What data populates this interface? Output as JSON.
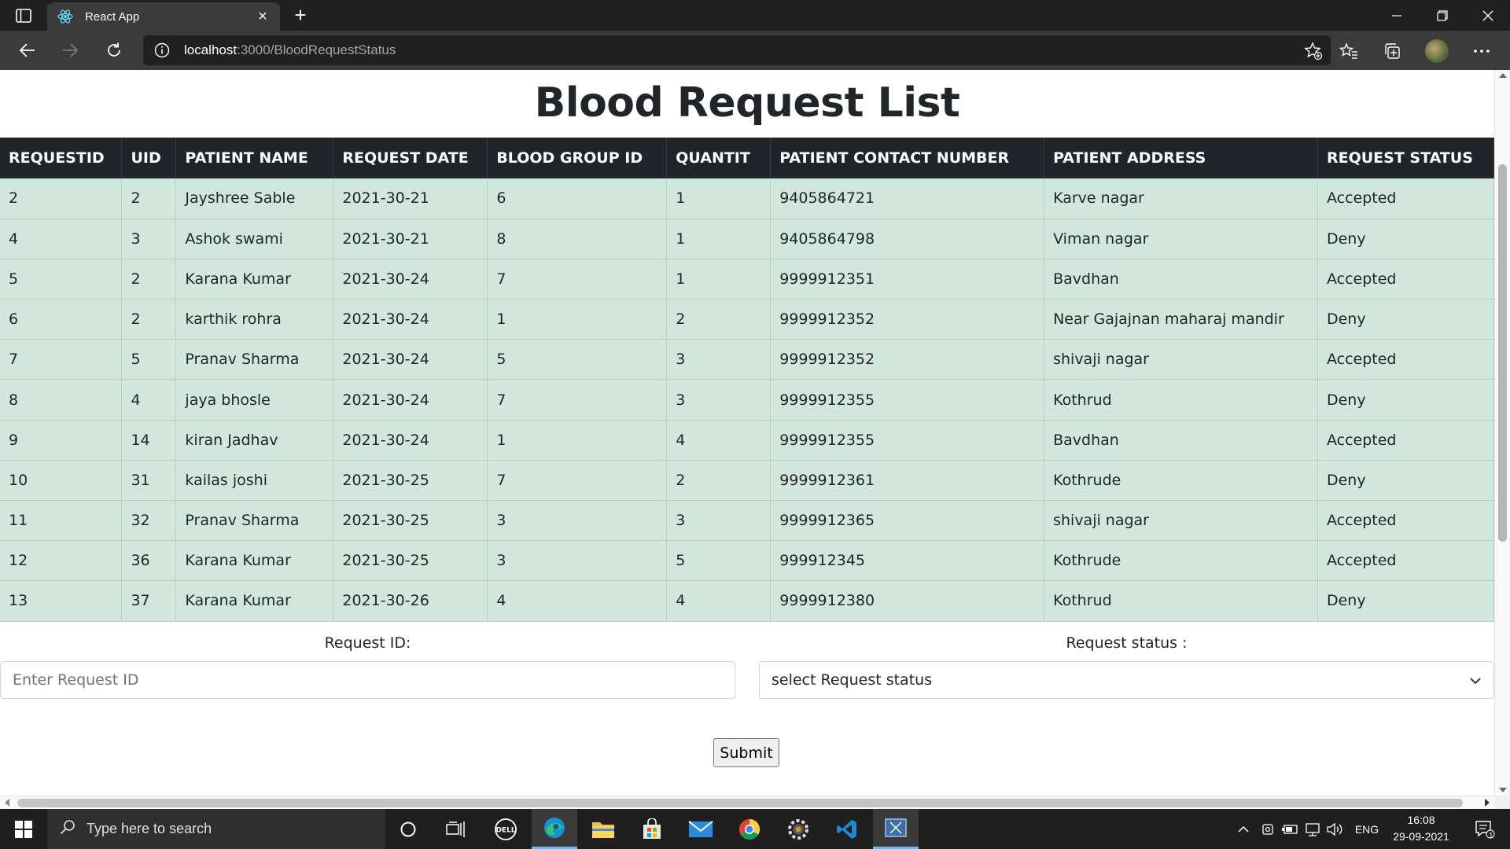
{
  "browser": {
    "tab_title": "React App",
    "url_host": "localhost",
    "url_path": ":3000/BloodRequestStatus"
  },
  "page": {
    "title": "Blood Request List"
  },
  "table": {
    "headers": [
      "REQUESTID",
      "UID",
      "PATIENT NAME",
      "REQUEST DATE",
      "BLOOD GROUP ID",
      "QUANTIT",
      "PATIENT CONTACT NUMBER",
      "PATIENT ADDRESS",
      "REQUEST STATUS"
    ],
    "rows": [
      [
        "2",
        "2",
        "Jayshree Sable",
        "2021-30-21",
        "6",
        "1",
        "9405864721",
        "Karve nagar",
        "Accepted"
      ],
      [
        "4",
        "3",
        "Ashok swami",
        "2021-30-21",
        "8",
        "1",
        "9405864798",
        "Viman nagar",
        "Deny"
      ],
      [
        "5",
        "2",
        "Karana Kumar",
        "2021-30-24",
        "7",
        "1",
        "9999912351",
        "Bavdhan",
        "Accepted"
      ],
      [
        "6",
        "2",
        "karthik rohra",
        "2021-30-24",
        "1",
        "2",
        "9999912352",
        "Near Gajajnan maharaj mandir",
        "Deny"
      ],
      [
        "7",
        "5",
        "Pranav Sharma",
        "2021-30-24",
        "5",
        "3",
        "9999912352",
        "shivaji nagar",
        "Accepted"
      ],
      [
        "8",
        "4",
        "jaya bhosle",
        "2021-30-24",
        "7",
        "3",
        "9999912355",
        "Kothrud",
        "Deny"
      ],
      [
        "9",
        "14",
        "kiran Jadhav",
        "2021-30-24",
        "1",
        "4",
        "9999912355",
        "Bavdhan",
        "Accepted"
      ],
      [
        "10",
        "31",
        "kailas joshi",
        "2021-30-25",
        "7",
        "2",
        "9999912361",
        "Kothrude",
        "Deny"
      ],
      [
        "11",
        "32",
        "Pranav Sharma",
        "2021-30-25",
        "3",
        "3",
        "9999912365",
        "shivaji nagar",
        "Accepted"
      ],
      [
        "12",
        "36",
        "Karana Kumar",
        "2021-30-25",
        "3",
        "5",
        "999912345",
        "Kothrude",
        "Accepted"
      ],
      [
        "13",
        "37",
        "Karana Kumar",
        "2021-30-26",
        "4",
        "4",
        "9999912380",
        "Kothrud",
        "Deny"
      ]
    ]
  },
  "form": {
    "request_id_label": "Request ID:",
    "request_id_placeholder": "Enter Request ID",
    "request_id_value": "",
    "status_label": "Request status :",
    "status_selected": "select Request status",
    "submit_label": "Submit"
  },
  "taskbar": {
    "search_placeholder": "Type here to search",
    "language": "ENG",
    "time": "16:08",
    "date": "29-09-2021",
    "notification_count": "1"
  },
  "colors": {
    "table_header_bg": "#212529",
    "table_row_bg": "#d1e7dd",
    "chrome_dark": "#202020",
    "chrome_toolbar": "#3b3b3b"
  }
}
